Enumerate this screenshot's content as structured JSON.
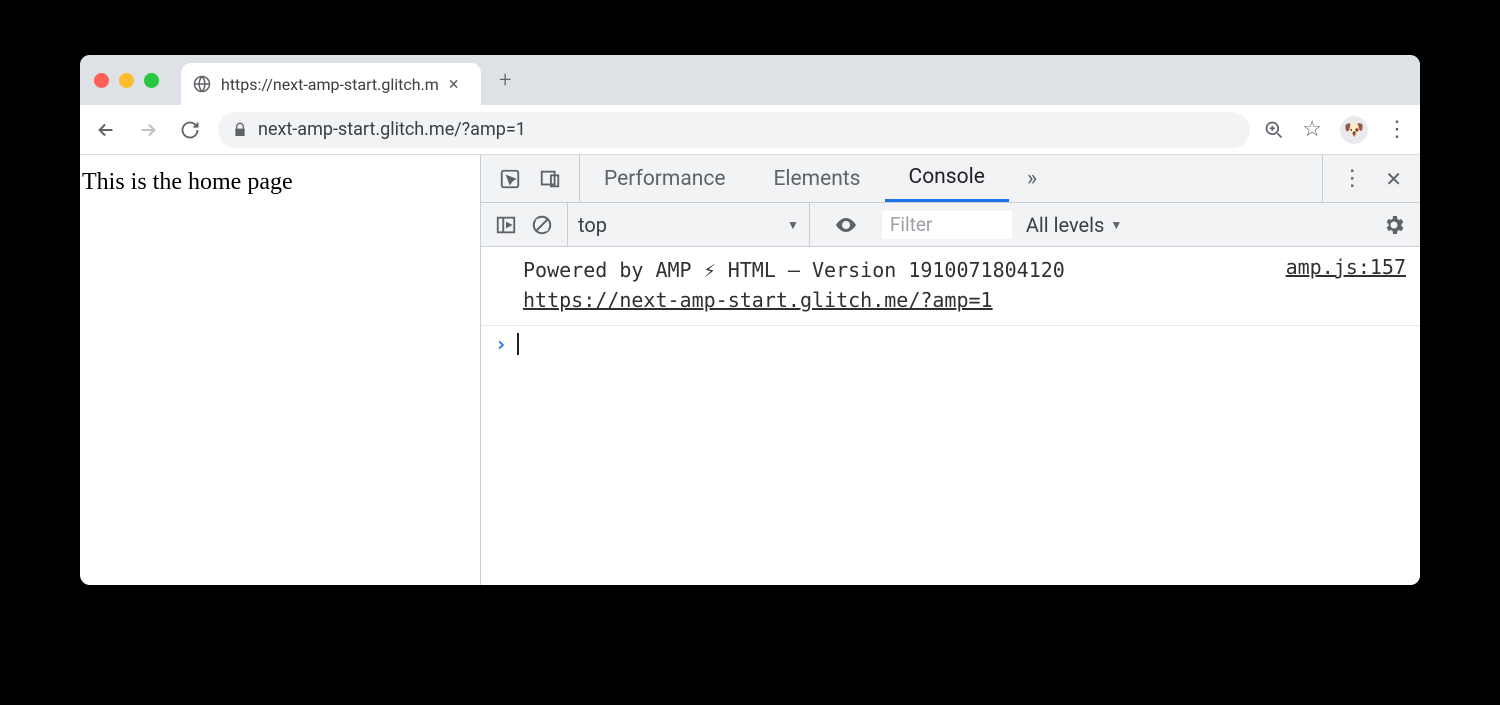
{
  "browser": {
    "tab_title": "https://next-amp-start.glitch.m",
    "url": "next-amp-start.glitch.me/?amp=1",
    "new_tab_glyph": "+",
    "close_glyph": "×"
  },
  "page": {
    "body_text": "This is the home page"
  },
  "devtools": {
    "tabs": {
      "performance": "Performance",
      "elements": "Elements",
      "console": "Console",
      "more_glyph": "»"
    },
    "console_toolbar": {
      "context": "top",
      "filter_placeholder": "Filter",
      "levels_label": "All levels",
      "dropdown_glyph": "▼"
    },
    "console_log": {
      "message_line1": "Powered by AMP ⚡ HTML – Version 1910071804120",
      "message_line2": "https://next-amp-start.glitch.me/?amp=1",
      "source": "amp.js:157"
    },
    "prompt_glyph": "›"
  },
  "icons": {
    "kebab": "⋮",
    "close_x": "✕",
    "star": "☆",
    "avatar_emoji": "🐶"
  }
}
